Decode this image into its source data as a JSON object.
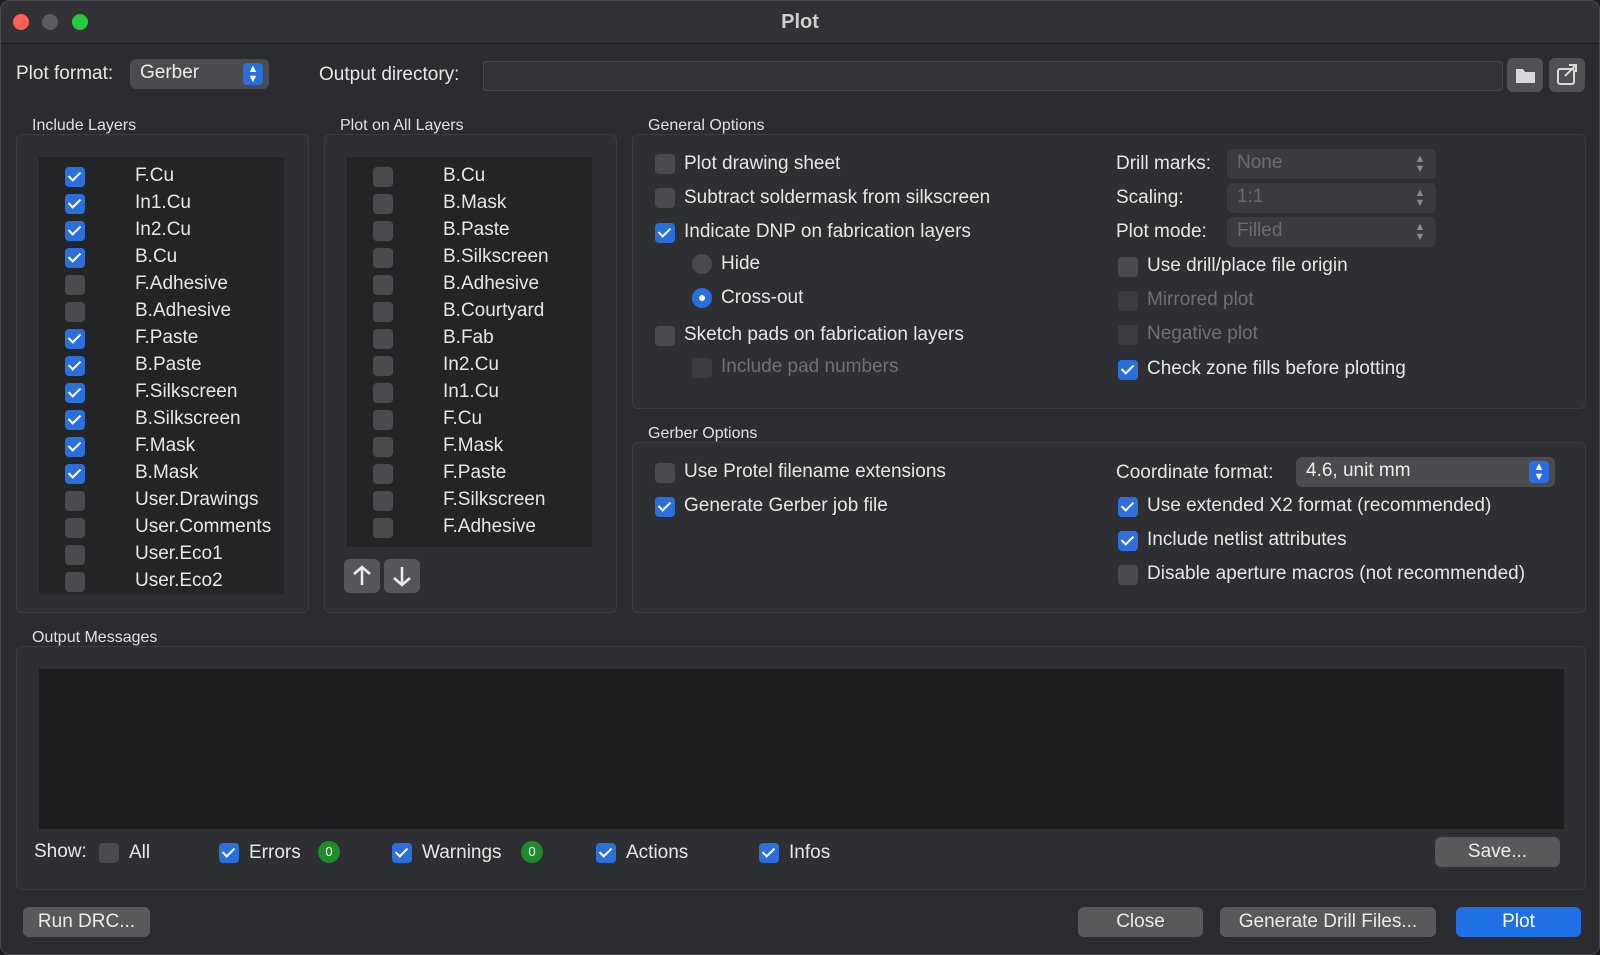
{
  "window": {
    "title": "Plot"
  },
  "top": {
    "plot_format_label": "Plot format:",
    "plot_format_value": "Gerber",
    "output_dir_label": "Output directory:",
    "output_dir_value": ""
  },
  "include_layers": {
    "title": "Include Layers",
    "items": [
      {
        "label": "F.Cu",
        "checked": true
      },
      {
        "label": "In1.Cu",
        "checked": true
      },
      {
        "label": "In2.Cu",
        "checked": true
      },
      {
        "label": "B.Cu",
        "checked": true
      },
      {
        "label": "F.Adhesive",
        "checked": false
      },
      {
        "label": "B.Adhesive",
        "checked": false
      },
      {
        "label": "F.Paste",
        "checked": true
      },
      {
        "label": "B.Paste",
        "checked": true
      },
      {
        "label": "F.Silkscreen",
        "checked": true
      },
      {
        "label": "B.Silkscreen",
        "checked": true
      },
      {
        "label": "F.Mask",
        "checked": true
      },
      {
        "label": "B.Mask",
        "checked": true
      },
      {
        "label": "User.Drawings",
        "checked": false
      },
      {
        "label": "User.Comments",
        "checked": false
      },
      {
        "label": "User.Eco1",
        "checked": false
      },
      {
        "label": "User.Eco2",
        "checked": false
      }
    ]
  },
  "plot_all_layers": {
    "title": "Plot on All Layers",
    "items": [
      {
        "label": "B.Cu",
        "checked": false
      },
      {
        "label": "B.Mask",
        "checked": false
      },
      {
        "label": "B.Paste",
        "checked": false
      },
      {
        "label": "B.Silkscreen",
        "checked": false
      },
      {
        "label": "B.Adhesive",
        "checked": false
      },
      {
        "label": "B.Courtyard",
        "checked": false
      },
      {
        "label": "B.Fab",
        "checked": false
      },
      {
        "label": "In2.Cu",
        "checked": false
      },
      {
        "label": "In1.Cu",
        "checked": false
      },
      {
        "label": "F.Cu",
        "checked": false
      },
      {
        "label": "F.Mask",
        "checked": false
      },
      {
        "label": "F.Paste",
        "checked": false
      },
      {
        "label": "F.Silkscreen",
        "checked": false
      },
      {
        "label": "F.Adhesive",
        "checked": false
      }
    ]
  },
  "general": {
    "title": "General Options",
    "plot_drawing_sheet": "Plot drawing sheet",
    "subtract_soldermask": "Subtract soldermask from silkscreen",
    "indicate_dnp": "Indicate DNP on fabrication layers",
    "hide": "Hide",
    "cross_out": "Cross-out",
    "sketch_pads": "Sketch pads on fabrication layers",
    "include_pad_numbers": "Include pad numbers",
    "drill_marks_label": "Drill marks:",
    "drill_marks_value": "None",
    "scaling_label": "Scaling:",
    "scaling_value": "1:1",
    "plot_mode_label": "Plot mode:",
    "plot_mode_value": "Filled",
    "use_drill_origin": "Use drill/place file origin",
    "mirrored_plot": "Mirrored plot",
    "negative_plot": "Negative plot",
    "check_zone_fills": "Check zone fills before plotting"
  },
  "gerber": {
    "title": "Gerber Options",
    "protel": "Use Protel filename extensions",
    "job_file": "Generate Gerber job file",
    "coord_label": "Coordinate format:",
    "coord_value": "4.6, unit mm",
    "x2": "Use extended X2 format (recommended)",
    "netlist": "Include netlist attributes",
    "aperture": "Disable aperture macros (not recommended)"
  },
  "messages": {
    "title": "Output Messages",
    "show_label": "Show:",
    "all": "All",
    "errors": "Errors",
    "errors_count": "0",
    "warnings": "Warnings",
    "warnings_count": "0",
    "actions": "Actions",
    "infos": "Infos",
    "save": "Save..."
  },
  "footer": {
    "run_drc": "Run DRC...",
    "close": "Close",
    "drill": "Generate Drill Files...",
    "plot": "Plot"
  }
}
